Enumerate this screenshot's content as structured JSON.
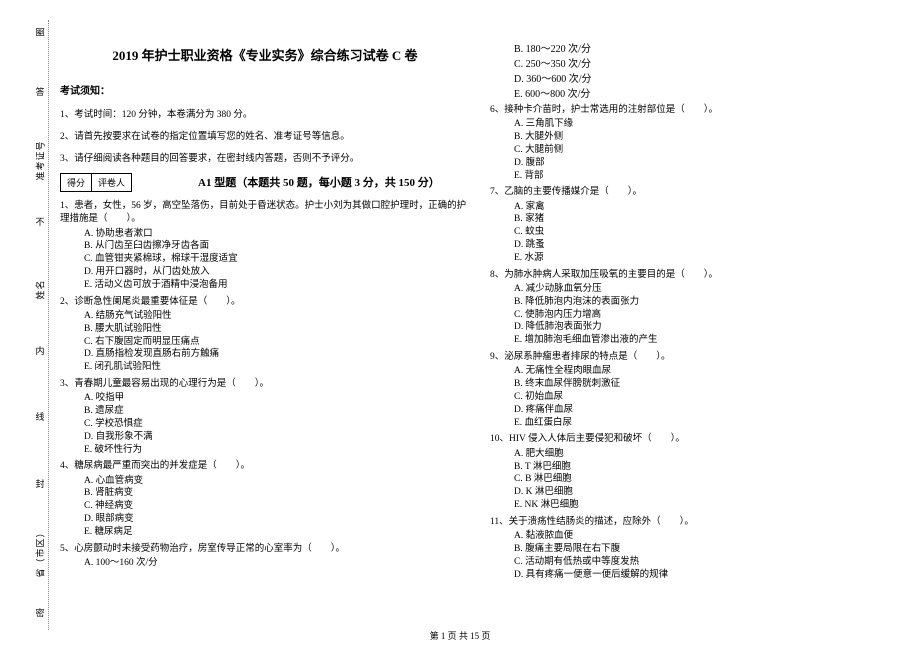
{
  "side": {
    "circle_top": "圈",
    "exam_no_label": "准考证号",
    "name_label": "姓名",
    "region_label": "省（市区）",
    "marks": [
      "答",
      "内",
      "线",
      "封",
      "密",
      "不"
    ]
  },
  "header": {
    "title": "2019 年护士职业资格《专业实务》综合练习试卷 C 卷"
  },
  "notice": {
    "head": "考试须知：",
    "items": [
      "1、考试时间：120 分钟，本卷满分为 380 分。",
      "2、请首先按要求在试卷的指定位置填写您的姓名、准考证号等信息。",
      "3、请仔细阅读各种题目的回答要求，在密封线内答题，否则不予评分。"
    ]
  },
  "score_box": {
    "score": "得分",
    "grader": "评卷人"
  },
  "part_a": {
    "title": "A1 型题（本题共 50 题，每小题 3 分，共 150 分）"
  },
  "questions_left": [
    {
      "stem": "1、患者，女性，56 岁，高空坠落伤，目前处于昏迷状态。护士小刘为其做口腔护理时，正确的护理措施是（　　）。",
      "opts": [
        "A. 协助患者漱口",
        "B. 从门齿至臼齿擦净牙齿各面",
        "C. 血管钳夹紧棉球，棉球干湿度适宜",
        "D. 用开口器时，从门齿处放入",
        "E. 活动义齿可放于酒精中浸泡备用"
      ]
    },
    {
      "stem": "2、诊断急性阑尾炎最重要体征是（　　）。",
      "opts": [
        "A. 结肠充气试验阳性",
        "B. 腰大肌试验阳性",
        "C. 右下腹固定而明显压痛点",
        "D. 直肠指检发现直肠右前方触痛",
        "E. 闭孔肌试验阳性"
      ]
    },
    {
      "stem": "3、青春期儿童最容易出现的心理行为是（　　）。",
      "opts": [
        "A. 咬指甲",
        "B. 遗尿症",
        "C. 学校恐惧症",
        "D. 自我形象不满",
        "E. 破坏性行为"
      ]
    },
    {
      "stem": "4、糖尿病最严重而突出的并发症是（　　）。",
      "opts": [
        "A. 心血管病变",
        "B. 肾脏病变",
        "C. 神经病变",
        "D. 眼部病变",
        "E. 糖尿病足"
      ]
    },
    {
      "stem": "5、心房颤动时未接受药物治疗，房室传导正常的心室率为（　　）。",
      "opts": [
        "A. 100～160 次/分"
      ]
    }
  ],
  "q5_rest": [
    "B. 180～220 次/分",
    "C. 250～350 次/分",
    "D. 360～600 次/分",
    "E. 600～800 次/分"
  ],
  "questions_right": [
    {
      "stem": "6、接种卡介苗时，护士常选用的注射部位是（　　）。",
      "opts": [
        "A. 三角肌下缘",
        "B. 大腿外侧",
        "C. 大腿前侧",
        "D. 腹部",
        "E. 背部"
      ]
    },
    {
      "stem": "7、乙脑的主要传播媒介是（　　）。",
      "opts": [
        "A. 家禽",
        "B. 家猪",
        "C. 蚊虫",
        "D. 跳蚤",
        "E. 水源"
      ]
    },
    {
      "stem": "8、为肺水肿病人采取加压吸氧的主要目的是（　　）。",
      "opts": [
        "A. 减少动脉血氧分压",
        "B. 降低肺泡内泡沫的表面张力",
        "C. 使肺泡内压力增高",
        "D. 降低肺泡表面张力",
        "E. 增加肺泡毛细血管渗出液的产生"
      ]
    },
    {
      "stem": "9、泌尿系肿瘤患者排尿的特点是（　　）。",
      "opts": [
        "A. 无痛性全程肉眼血尿",
        "B. 终末血尿伴膀胱刺激征",
        "C. 初始血尿",
        "D. 疼痛伴血尿",
        "E. 血红蛋白尿"
      ]
    },
    {
      "stem": "10、HIV 侵入人体后主要侵犯和破坏（　　）。",
      "opts": [
        "A. 肥大细胞",
        "B. T 淋巴细胞",
        "C. B 淋巴细胞",
        "D. K 淋巴细胞",
        "E. NK 淋巴细胞"
      ]
    },
    {
      "stem": "11、关于溃疡性结肠炎的描述，应除外（　　）。",
      "opts": [
        "A. 黏液脓血便",
        "B. 腹痛主要局限在右下腹",
        "C. 活动期有低热或中等度发热",
        "D. 具有疼痛一便意一便后缓解的规律"
      ]
    }
  ],
  "footer": "第 1 页 共 15 页"
}
